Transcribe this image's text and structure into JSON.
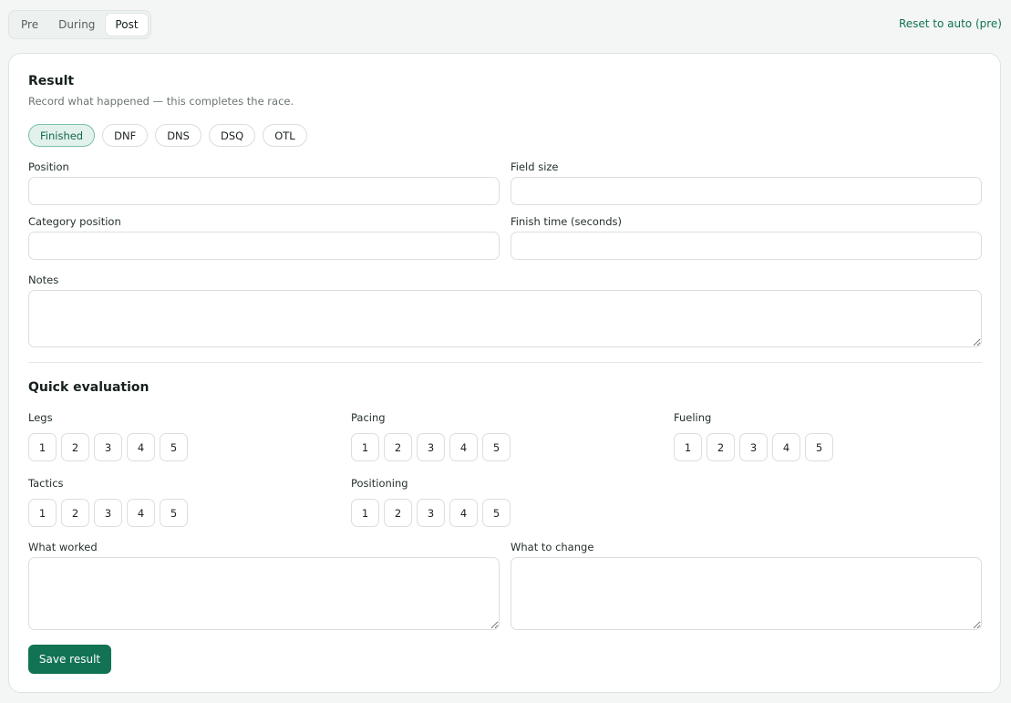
{
  "phase_tabs": {
    "items": [
      {
        "label": "Pre"
      },
      {
        "label": "During"
      },
      {
        "label": "Post"
      }
    ],
    "selected": "Post"
  },
  "reset_link": "Reset to auto (pre)",
  "result": {
    "title": "Result",
    "subtitle": "Record what happened — this completes the race.",
    "statuses": [
      "Finished",
      "DNF",
      "DNS",
      "DSQ",
      "OTL"
    ],
    "selected_status": "Finished",
    "position": {
      "label": "Position",
      "value": ""
    },
    "field_size": {
      "label": "Field size",
      "value": ""
    },
    "category_position": {
      "label": "Category position",
      "value": ""
    },
    "finish_time": {
      "label": "Finish time (seconds)",
      "value": ""
    },
    "notes": {
      "label": "Notes",
      "value": ""
    }
  },
  "evaluation": {
    "title": "Quick evaluation",
    "scale": [
      "1",
      "2",
      "3",
      "4",
      "5"
    ],
    "criteria": [
      {
        "label": "Legs"
      },
      {
        "label": "Pacing"
      },
      {
        "label": "Fueling"
      },
      {
        "label": "Tactics"
      },
      {
        "label": "Positioning"
      }
    ],
    "what_worked": {
      "label": "What worked",
      "value": ""
    },
    "what_to_change": {
      "label": "What to change",
      "value": ""
    }
  },
  "save_label": "Save result",
  "colors": {
    "accent": "#127254",
    "selected_chip_bg": "#e2f1eb",
    "page_bg": "#f3f6f5"
  }
}
